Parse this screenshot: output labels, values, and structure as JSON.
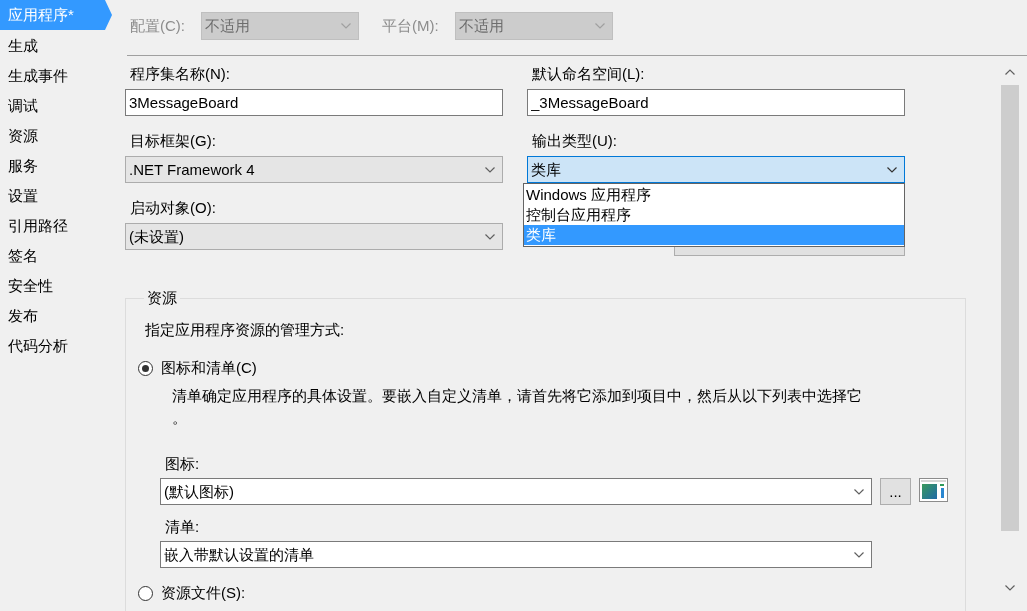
{
  "sidebar": {
    "items": [
      {
        "label": "应用程序*",
        "selected": true
      },
      {
        "label": "生成",
        "selected": false
      },
      {
        "label": "生成事件",
        "selected": false
      },
      {
        "label": "调试",
        "selected": false
      },
      {
        "label": "资源",
        "selected": false
      },
      {
        "label": "服务",
        "selected": false
      },
      {
        "label": "设置",
        "selected": false
      },
      {
        "label": "引用路径",
        "selected": false
      },
      {
        "label": "签名",
        "selected": false
      },
      {
        "label": "安全性",
        "selected": false
      },
      {
        "label": "发布",
        "selected": false
      },
      {
        "label": "代码分析",
        "selected": false
      }
    ]
  },
  "toolbar": {
    "fields": [
      {
        "label": "配置(C):",
        "value": "不适用",
        "disabled": true
      },
      {
        "label": "平台(M):",
        "value": "不适用",
        "disabled": true
      }
    ]
  },
  "application": {
    "fields": [
      {
        "kind": "text",
        "label": "程序集名称(N):",
        "value": "3MessageBoard"
      },
      {
        "kind": "text",
        "label": "默认命名空间(L):",
        "value": "_3MessageBoard"
      },
      {
        "kind": "dropdown",
        "label": "目标框架(G):",
        "value": ".NET Framework 4",
        "expanded": false
      },
      {
        "kind": "dropdown",
        "label": "输出类型(U):",
        "value": "类库",
        "expanded": true
      },
      {
        "kind": "dropdown",
        "label": "启动对象(O):",
        "value": "(未设置)",
        "expanded": false
      },
      {
        "kind": "button"
      }
    ],
    "dropdown_list": {
      "options": [
        {
          "label": "Windows 应用程序",
          "selected": false
        },
        {
          "label": "控制台应用程序",
          "selected": false
        },
        {
          "label": "类库",
          "selected": true
        }
      ]
    }
  },
  "resources": {
    "title": "资源",
    "prompt": "指定应用程序资源的管理方式:",
    "options": [
      {
        "kind": "icon_manifest",
        "label": "图标和清单(C)",
        "selected": true,
        "description": "清单确定应用程序的具体设置。要嵌入自定义清单，请首先将它添加到项目中，然后从以下列表中选择它。",
        "icon": {
          "label": "图标:",
          "value": "(默认图标)",
          "browse_button": "..."
        },
        "manifest": {
          "label": "清单:",
          "value": "嵌入带默认设置的清单"
        }
      },
      {
        "kind": "resource_file",
        "label": "资源文件(S):",
        "selected": false
      }
    ]
  }
}
